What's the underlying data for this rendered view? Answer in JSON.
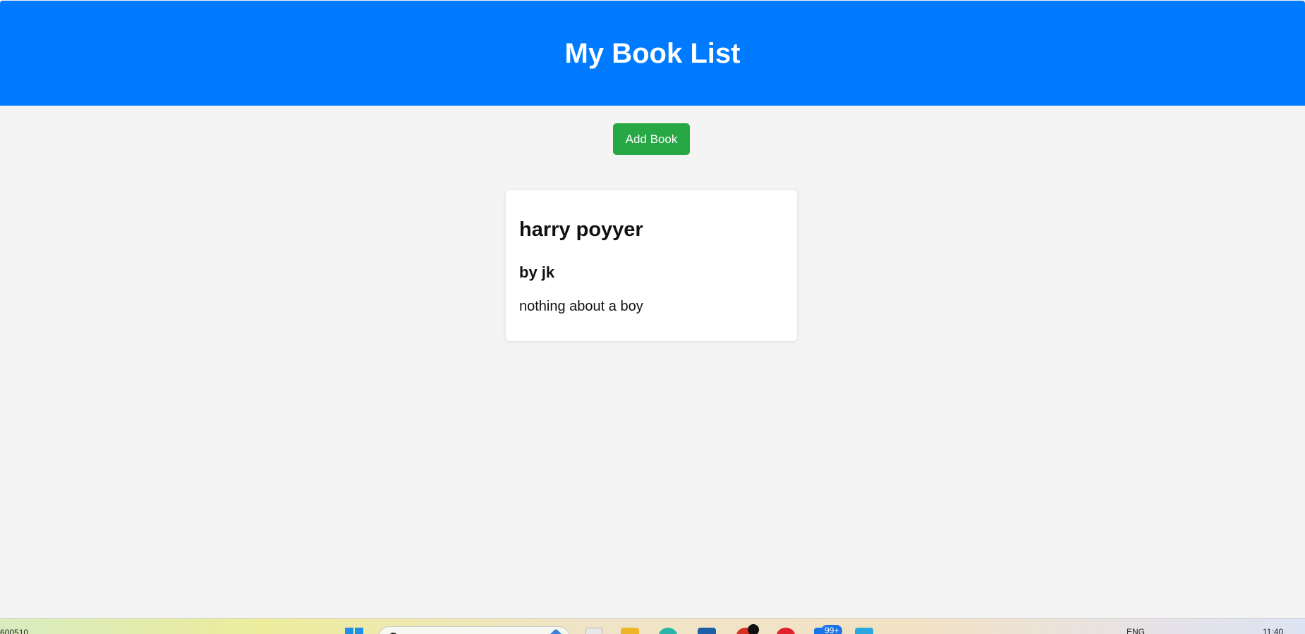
{
  "header": {
    "title": "My Book List"
  },
  "toolbar": {
    "add_label": "Add Book"
  },
  "books": [
    {
      "title": "harry poyyer",
      "author": "by jk",
      "description": "nothing about a boy"
    }
  ],
  "taskbar": {
    "left_text": "600510",
    "notification_badge": "99+",
    "language": "ENG",
    "time": "11:40"
  },
  "colors": {
    "header_bg": "#007bff",
    "add_button_bg": "#28a745",
    "page_bg": "#f4f4f4"
  }
}
